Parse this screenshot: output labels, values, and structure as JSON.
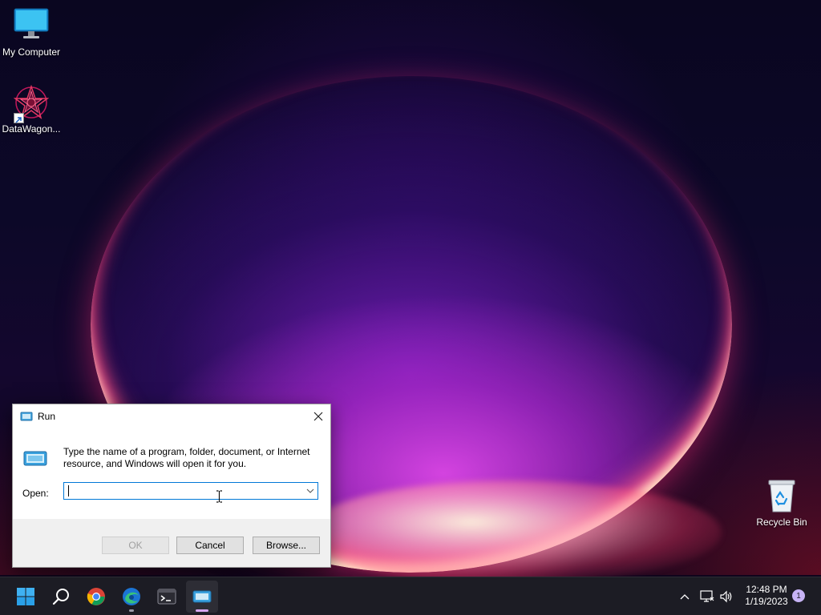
{
  "desktop": {
    "icons": [
      {
        "label": "My Computer",
        "icon": "monitor-icon"
      },
      {
        "label": "DataWagon...",
        "icon": "datawagon-app-icon"
      }
    ],
    "recycle_bin": {
      "label": "Recycle Bin",
      "icon": "recycle-bin-icon"
    }
  },
  "run_dialog": {
    "title": "Run",
    "icon": "run-icon",
    "description": "Type the name of a program, folder, document, or Internet resource, and Windows will open it for you.",
    "open_label": "Open:",
    "open_value": "",
    "buttons": {
      "ok": "OK",
      "cancel": "Cancel",
      "browse": "Browse..."
    }
  },
  "taskbar": {
    "apps": [
      {
        "icon": "windows-start-icon"
      },
      {
        "icon": "search-icon"
      },
      {
        "icon": "chrome-icon"
      },
      {
        "icon": "edge-icon"
      },
      {
        "icon": "terminal-icon"
      },
      {
        "icon": "run-icon",
        "active": true
      }
    ],
    "tray": {
      "icons": [
        "chevron-up-icon",
        "network-icon",
        "volume-icon"
      ],
      "time": "12:48 PM",
      "date": "1/19/2023",
      "notification_count": "1"
    }
  },
  "colors": {
    "taskbar_bg": "#1c1c24",
    "accent": "#0078d7",
    "active_indicator": "#d6a6f0",
    "badge": "#c7b3f5"
  }
}
